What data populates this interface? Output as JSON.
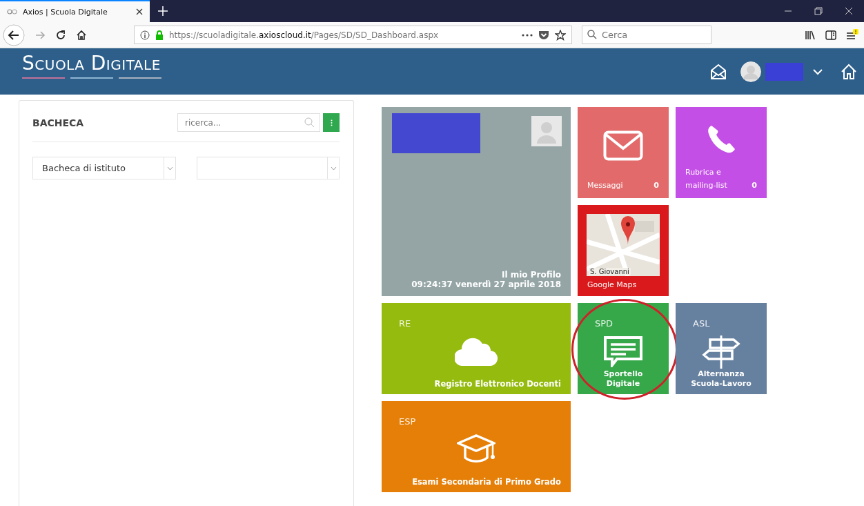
{
  "browser": {
    "tab": {
      "title": "Axios | Scuola Digitale",
      "selected": true
    },
    "url": {
      "prefix": "https://scuoladigitale.",
      "host": "axioscloud.it",
      "path": "/Pages/SD/SD_Dashboard.aspx"
    },
    "search": {
      "placeholder": "Cerca"
    },
    "forward_disabled": true
  },
  "header": {
    "logo": "Scuola Digitale"
  },
  "bacheca": {
    "title": "BACHECA",
    "search": {
      "placeholder": "ricerca..."
    },
    "selects": [
      {
        "kind": "select",
        "value": "Bacheca di istituto"
      },
      {
        "kind": "select"
      }
    ]
  },
  "tiles": [
    {
      "kind": "profile",
      "title": "Il mio Profilo",
      "subtitle": "09:24:37 venerdì 27 aprile 2018",
      "color": "#95a5a6",
      "annotated": false
    },
    {
      "kind": "messages",
      "label": "Messaggi",
      "count": "0",
      "color": "#e36a6a",
      "annotated": false
    },
    {
      "kind": "contacts",
      "label": "Rubrica e mailing-list",
      "count": "0",
      "color": "#c44fe6",
      "annotated": false
    },
    {
      "kind": "map",
      "label": "Google Maps",
      "map_label": "S. Giovanni",
      "color": "#d9191b",
      "annotated": false
    },
    {
      "kind": "register",
      "code": "RE",
      "label": "Registro Elettronico Docenti",
      "color": "#95bb0e",
      "annotated": false
    },
    {
      "kind": "desk",
      "code": "SPD",
      "label": "Sportello Digitale",
      "color": "#36a84a",
      "annotated": true
    },
    {
      "kind": "worklink",
      "code": "ASL",
      "label": "Alternanza Scuola-Lavoro",
      "color": "#66809f",
      "annotated": false
    },
    {
      "kind": "exams",
      "code": "ESP",
      "label": "Esami Secondaria di Primo Grado",
      "color": "#e57f08",
      "annotated": false
    }
  ]
}
